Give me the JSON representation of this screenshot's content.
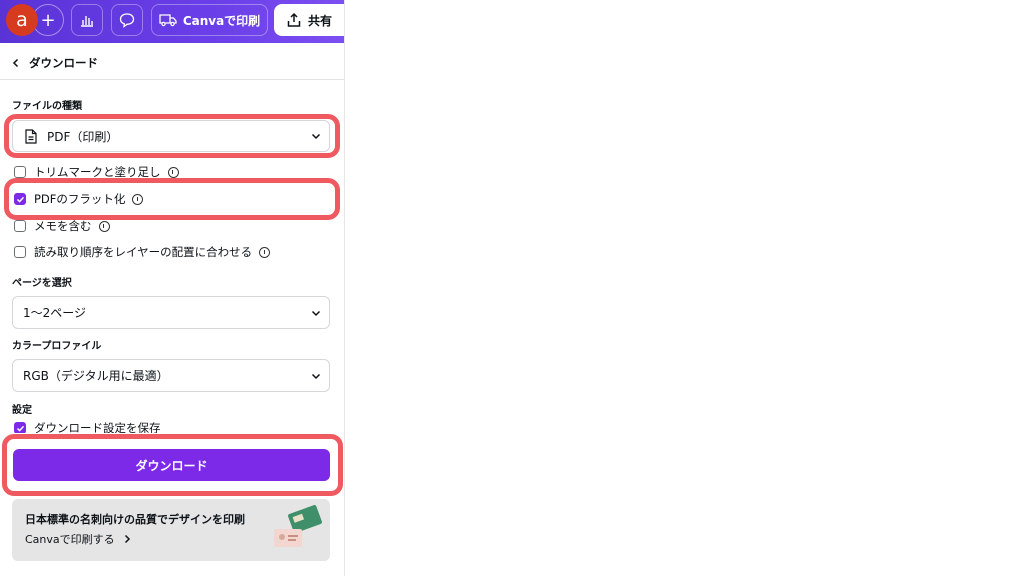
{
  "topbar": {
    "avatar_letter": "a",
    "print_label": "Canvaで印刷",
    "share_label": "共有"
  },
  "header": {
    "title": "ダウンロード"
  },
  "file_type": {
    "heading": "ファイルの種類",
    "selected": "PDF（印刷）"
  },
  "options": [
    {
      "label": "トリムマークと塗り足し",
      "checked": false,
      "info": true
    },
    {
      "label": "PDFのフラット化",
      "checked": true,
      "info": true
    },
    {
      "label": "メモを含む",
      "checked": false,
      "info": true
    },
    {
      "label": "読み取り順序をレイヤーの配置に合わせる",
      "checked": false,
      "info": true
    }
  ],
  "pages": {
    "heading": "ページを選択",
    "selected": "1〜2ページ"
  },
  "color_profile": {
    "heading": "カラープロファイル",
    "selected": "RGB（デジタル用に最適）"
  },
  "settings": {
    "heading": "設定",
    "save_label": "ダウンロード設定を保存",
    "save_checked": true
  },
  "download_button": "ダウンロード",
  "promo": {
    "title": "日本標準の名刺向けの品質でデザインを印刷",
    "link": "Canvaで印刷する"
  },
  "colors": {
    "accent": "#7d2ae8",
    "highlight": "#ee5a60",
    "topbar": "#6a3ee8"
  }
}
